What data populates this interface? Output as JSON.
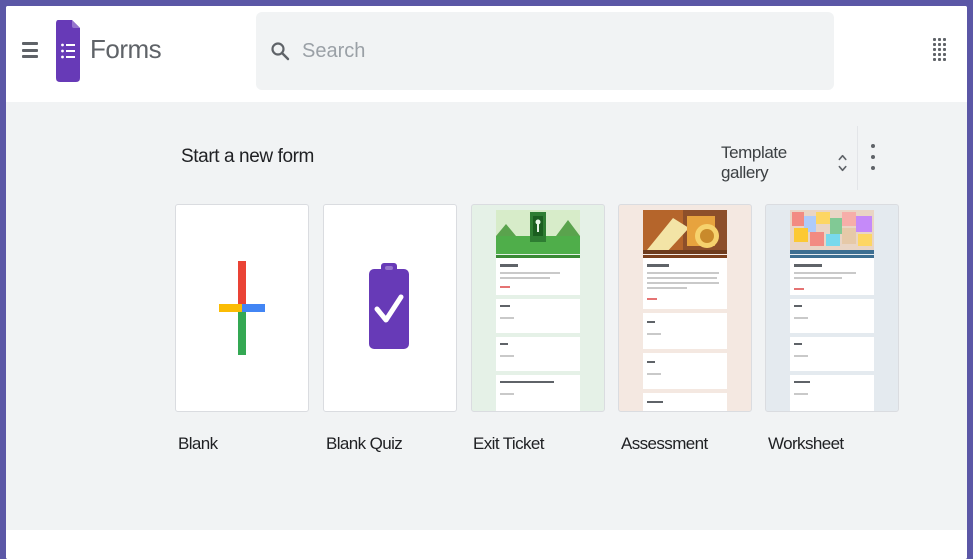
{
  "header": {
    "app_title": "Forms",
    "search_placeholder": "Search",
    "icons": {
      "menu": "hamburger-menu-icon",
      "logo": "google-forms-logo",
      "search": "search-icon",
      "apps": "apps-grid-icon"
    }
  },
  "main": {
    "section_title": "Start a new form",
    "template_gallery_label": "Template gallery",
    "icons": {
      "gallery_toggle": "unfold-more-icon",
      "more": "more-vert-icon"
    },
    "templates": [
      {
        "label": "Blank",
        "thumbnail": "plus-icon"
      },
      {
        "label": "Blank Quiz",
        "thumbnail": "quiz-clipboard-icon"
      },
      {
        "label": "Exit Ticket",
        "thumbnail": "exit-ticket-preview"
      },
      {
        "label": "Assessment",
        "thumbnail": "assessment-preview"
      },
      {
        "label": "Worksheet",
        "thumbnail": "worksheet-preview"
      }
    ]
  },
  "colors": {
    "forms_purple": "#673ab7",
    "plus_red": "#ea4335",
    "plus_blue": "#4285f4",
    "plus_yellow": "#fbbc04",
    "plus_green": "#34a853",
    "page_background": "#f1f3f4",
    "outer_frame": "#5b57a6"
  }
}
